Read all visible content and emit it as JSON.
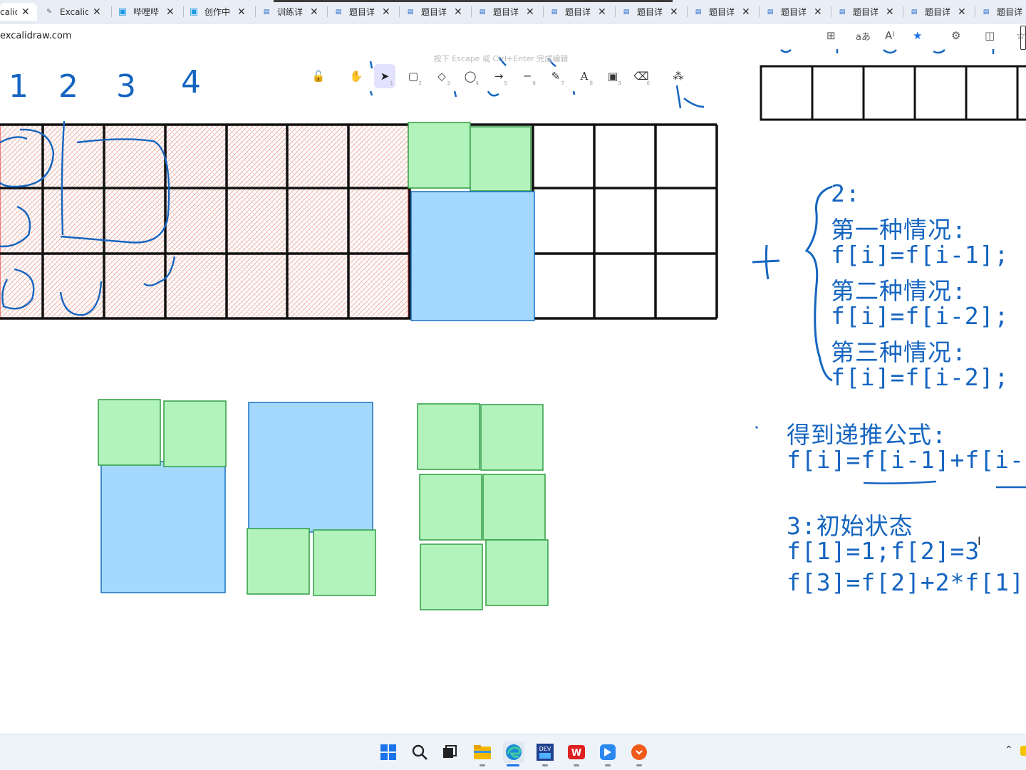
{
  "tabs": [
    {
      "title": "calid",
      "icon": "excalidraw-icon",
      "active": true
    },
    {
      "title": "Excalid",
      "icon": "excalidraw-icon"
    },
    {
      "title": "哔哩哔",
      "icon": "bilibili-icon"
    },
    {
      "title": "创作中",
      "icon": "bilibili-icon"
    },
    {
      "title": "训练详",
      "icon": "doc-icon"
    },
    {
      "title": "题目详",
      "icon": "doc-icon"
    },
    {
      "title": "题目详",
      "icon": "doc-icon"
    },
    {
      "title": "题目详",
      "icon": "doc-icon"
    },
    {
      "title": "题目详",
      "icon": "doc-icon"
    },
    {
      "title": "题目详",
      "icon": "doc-icon"
    },
    {
      "title": "题目详",
      "icon": "doc-icon"
    },
    {
      "title": "题目详",
      "icon": "doc-icon"
    },
    {
      "title": "题目详",
      "icon": "doc-icon"
    },
    {
      "title": "题目详",
      "icon": "doc-icon"
    },
    {
      "title": "题目详",
      "icon": "doc-icon"
    }
  ],
  "url": "excalidraw.com",
  "editor_hint": "按下 Escape 或 Ctrl+Enter 完成编辑",
  "toolbar": [
    {
      "icon": "lock-icon",
      "glyph": "🔓",
      "key": ""
    },
    {
      "icon": "hand-icon",
      "glyph": "✋",
      "key": ""
    },
    {
      "icon": "selection-icon",
      "glyph": "➤",
      "key": "1",
      "active": true
    },
    {
      "icon": "rectangle-icon",
      "glyph": "▢",
      "key": "2"
    },
    {
      "icon": "diamond-icon",
      "glyph": "◇",
      "key": "3"
    },
    {
      "icon": "ellipse-icon",
      "glyph": "◯",
      "key": "4"
    },
    {
      "icon": "arrow-icon",
      "glyph": "→",
      "key": "5"
    },
    {
      "icon": "line-icon",
      "glyph": "─",
      "key": "6"
    },
    {
      "icon": "pencil-icon",
      "glyph": "✎",
      "key": "7"
    },
    {
      "icon": "text-icon",
      "glyph": "A",
      "key": "8"
    },
    {
      "icon": "image-icon",
      "glyph": "▣",
      "key": "9"
    },
    {
      "icon": "eraser-icon",
      "glyph": "⌫",
      "key": "0"
    },
    {
      "icon": "shapes-icon",
      "glyph": "⁂",
      "key": ""
    }
  ],
  "handwriting": {
    "digits": [
      "1",
      "2",
      "3",
      "4"
    ],
    "plus": "+"
  },
  "notes": {
    "line1": "2:",
    "line2": "第一种情况:",
    "line3": "f[i]=f[i-1];",
    "line4": "第二种情况:",
    "line5": "f[i]=f[i-2];",
    "line6": "第三种情况:",
    "line7": "f[i]=f[i-2];",
    "recur_title": "得到递推公式:",
    "recur_formula": "f[i]=f[i-1]+f[i-",
    "init_title": "3:初始状态",
    "init_1": "f[1]=1;f[2]=3",
    "init_2": "f[3]=f[2]+2*f[1]"
  },
  "colors": {
    "green_fill": "#b2f2bb",
    "green_stroke": "#2f9e44",
    "blue_fill": "#a5d8ff",
    "blue_stroke": "#1971c2",
    "pen_blue": "#1565c0",
    "hatch_red": "#e03131"
  },
  "taskbar": [
    {
      "icon": "windows-start-icon"
    },
    {
      "icon": "search-icon"
    },
    {
      "icon": "task-view-icon"
    },
    {
      "icon": "file-explorer-icon"
    },
    {
      "icon": "edge-browser-icon"
    },
    {
      "icon": "dev-cpp-icon"
    },
    {
      "icon": "wps-office-icon"
    },
    {
      "icon": "feishu-icon"
    },
    {
      "icon": "app-orange-icon"
    }
  ]
}
